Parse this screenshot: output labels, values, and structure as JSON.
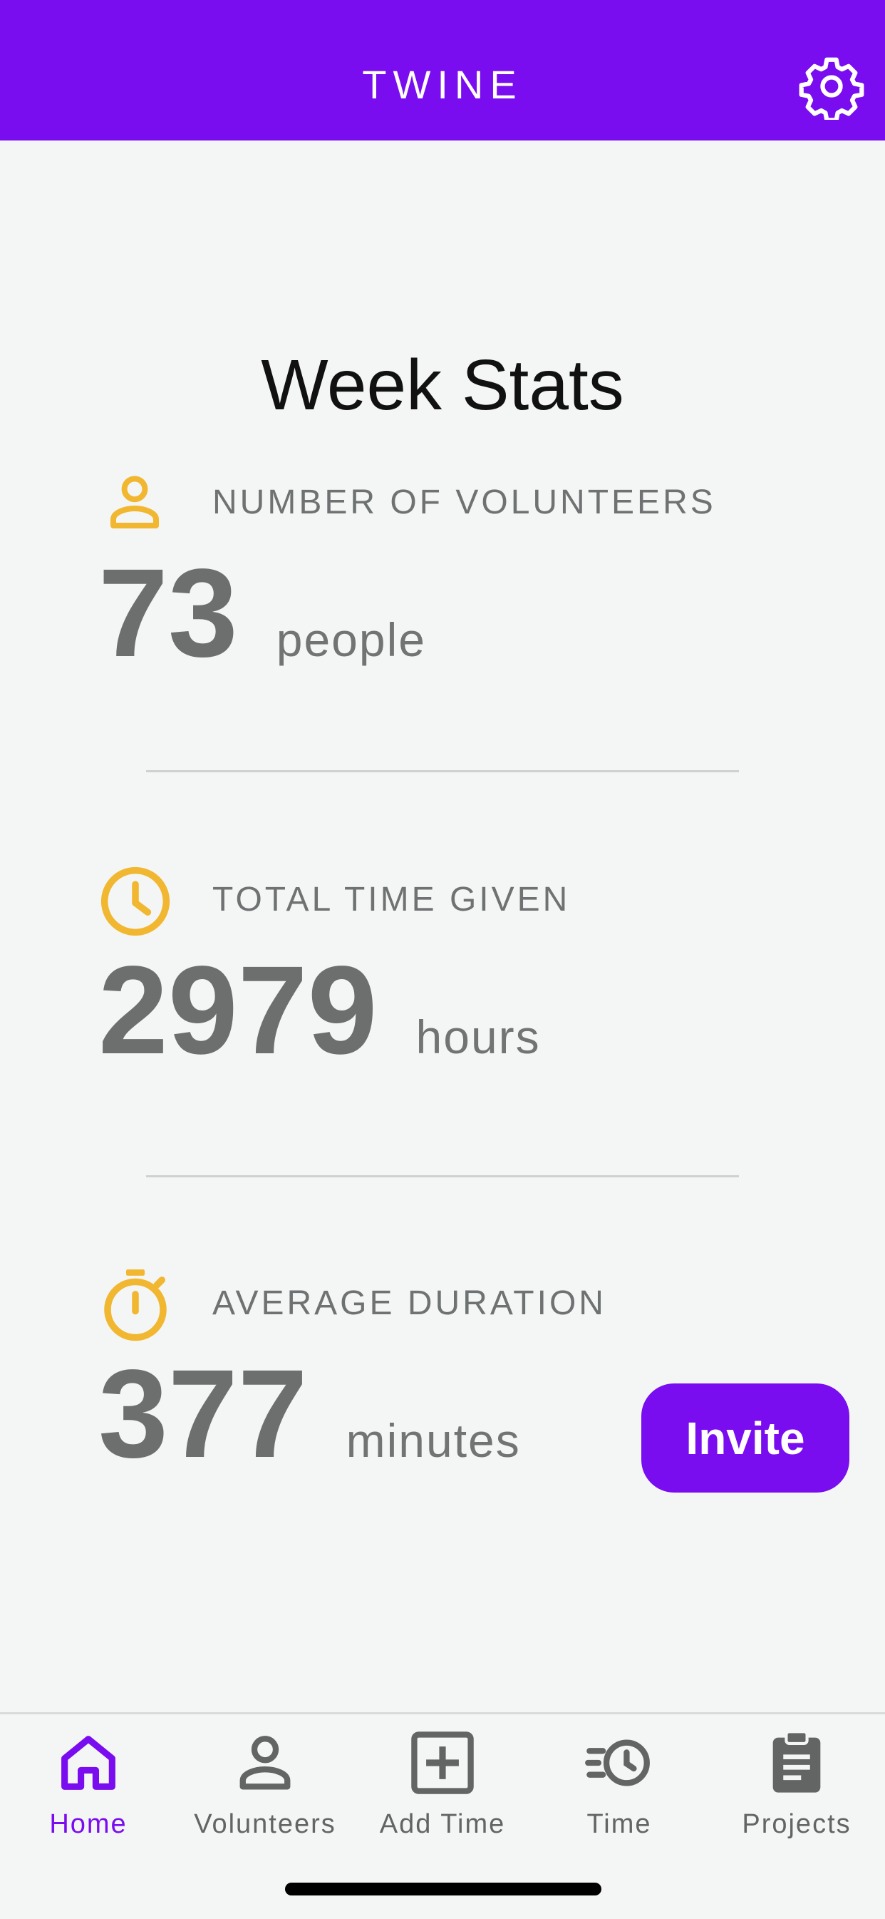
{
  "header": {
    "title": "TWINE",
    "settings_icon": "gear-icon"
  },
  "page": {
    "title": "Week Stats"
  },
  "stats": [
    {
      "label": "NUMBER OF VOLUNTEERS",
      "value": "73",
      "unit": "people",
      "icon": "person-icon"
    },
    {
      "label": "TOTAL TIME GIVEN",
      "value": "2979",
      "unit": "hours",
      "icon": "clock-icon"
    },
    {
      "label": "AVERAGE DURATION",
      "value": "377",
      "unit": "minutes",
      "icon": "stopwatch-icon"
    }
  ],
  "invite_button": {
    "label": "Invite"
  },
  "nav": {
    "items": [
      {
        "label": "Home",
        "icon": "home-icon",
        "active": true
      },
      {
        "label": "Volunteers",
        "icon": "person-icon",
        "active": false
      },
      {
        "label": "Add Time",
        "icon": "add-box-icon",
        "active": false
      },
      {
        "label": "Time",
        "icon": "history-clock-icon",
        "active": false
      },
      {
        "label": "Projects",
        "icon": "clipboard-icon",
        "active": false
      }
    ]
  },
  "colors": {
    "brand": "#7a0cf0",
    "accent_icon": "#f1b731",
    "background": "#f4f6f5",
    "nav_inactive": "#636565"
  }
}
